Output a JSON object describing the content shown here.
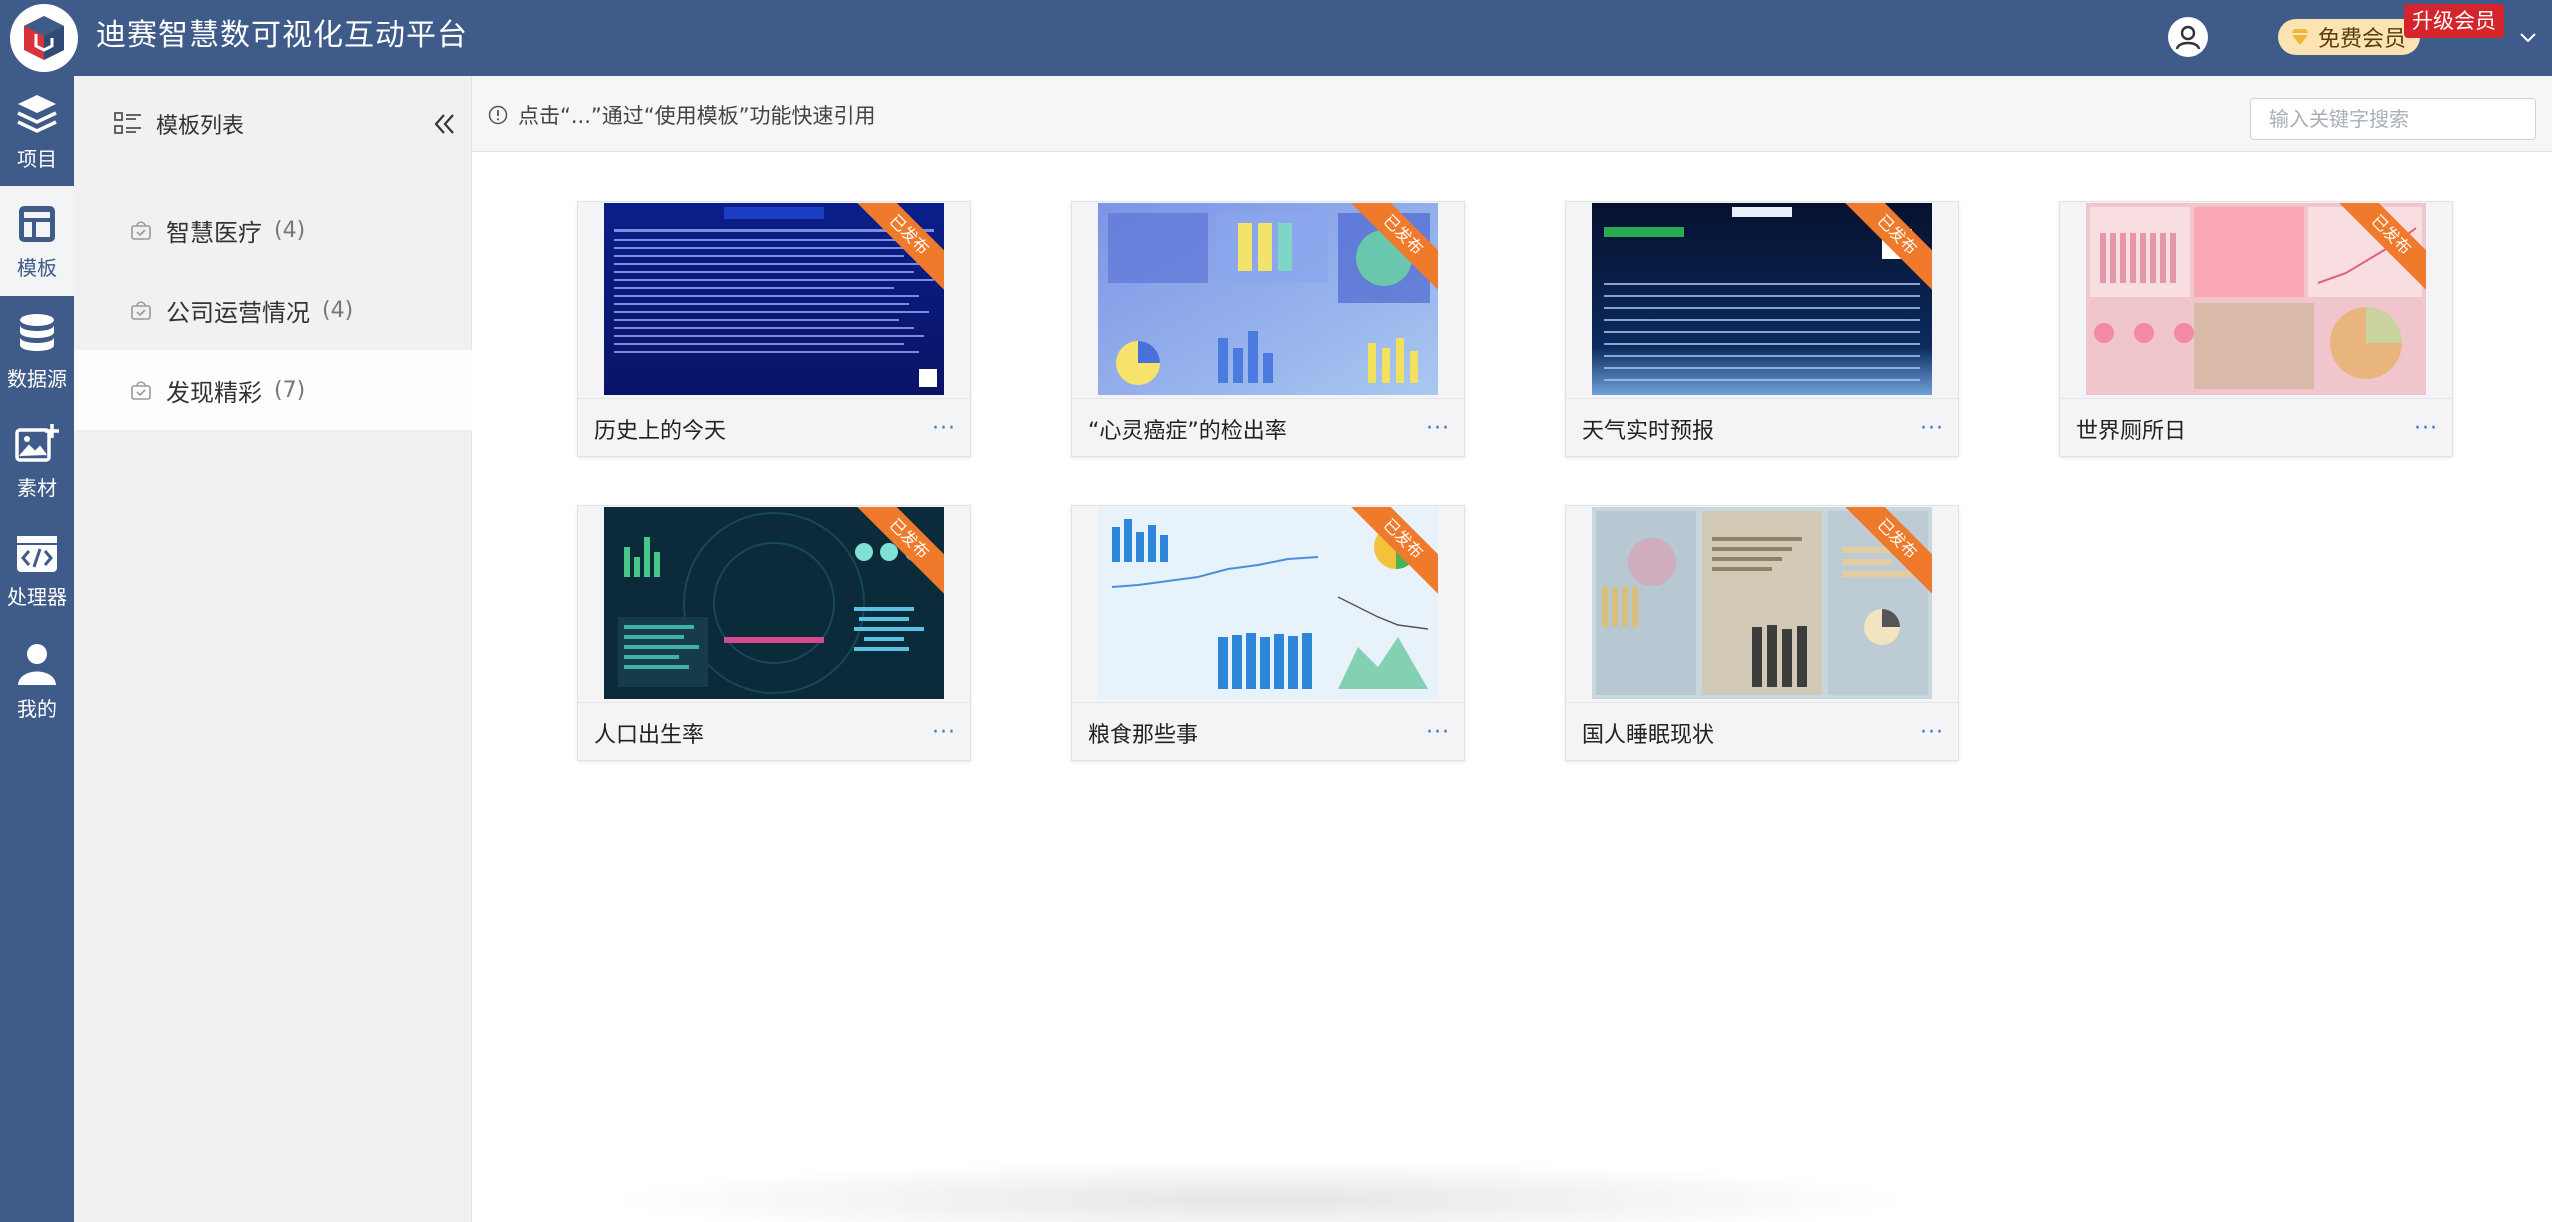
{
  "app": {
    "title": "迪赛智慧数可视化互动平台"
  },
  "header": {
    "username": "",
    "member_label": "免费会员",
    "upgrade_label": "升级会员"
  },
  "leftnav": [
    {
      "label": "项目",
      "icon": "layers-icon"
    },
    {
      "label": "模板",
      "icon": "template-icon",
      "active": true
    },
    {
      "label": "数据源",
      "icon": "database-icon"
    },
    {
      "label": "素材",
      "icon": "image-add-icon"
    },
    {
      "label": "处理器",
      "icon": "code-icon"
    },
    {
      "label": "我的",
      "icon": "user-icon"
    }
  ],
  "sidebar": {
    "title": "模板列表",
    "categories": [
      {
        "name": "智慧医疗",
        "count": "(4)"
      },
      {
        "name": "公司运营情况",
        "count": "(4)"
      },
      {
        "name": "发现精彩",
        "count": "(7)",
        "active": true
      }
    ]
  },
  "topbar": {
    "hint": "点击“...”通过“使用模板”功能快速引用",
    "search_placeholder": "输入关键字搜索"
  },
  "templates": [
    {
      "title": "历史上的今天",
      "badge": "已发布",
      "more": "···"
    },
    {
      "title": "“心灵癌症”的检出率",
      "badge": "已发布",
      "more": "···"
    },
    {
      "title": "天气实时预报",
      "badge": "已发布",
      "more": "···"
    },
    {
      "title": "世界厕所日",
      "badge": "已发布",
      "more": "···"
    },
    {
      "title": "人口出生率",
      "badge": "已发布",
      "more": "···"
    },
    {
      "title": "粮食那些事",
      "badge": "已发布",
      "more": "···"
    },
    {
      "title": "国人睡眠现状",
      "badge": "已发布",
      "more": "···"
    }
  ],
  "colors": {
    "brand": "#3e5b8a",
    "ribbon": "#f07a2b",
    "upgrade": "#d3252b",
    "link": "#3a7bd5"
  }
}
